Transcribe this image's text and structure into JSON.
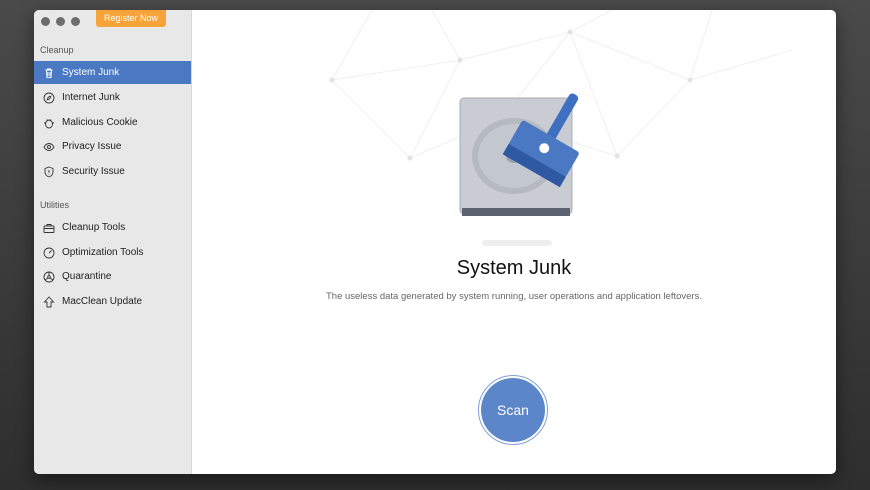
{
  "header": {
    "register_label": "Register Now"
  },
  "sidebar": {
    "cleanup_title": "Cleanup",
    "cleanup_items": [
      {
        "label": "System Junk",
        "icon": "trash-icon"
      },
      {
        "label": "Internet Junk",
        "icon": "compass-icon"
      },
      {
        "label": "Malicious Cookie",
        "icon": "cookie-bug-icon"
      },
      {
        "label": "Privacy Issue",
        "icon": "eye-icon"
      },
      {
        "label": "Security Issue",
        "icon": "shield-icon"
      }
    ],
    "utilities_title": "Utilities",
    "utility_items": [
      {
        "label": "Cleanup Tools",
        "icon": "toolbox-icon"
      },
      {
        "label": "Optimization Tools",
        "icon": "gauge-icon"
      },
      {
        "label": "Quarantine",
        "icon": "biohazard-icon"
      },
      {
        "label": "MacClean Update",
        "icon": "arrow-up-icon"
      }
    ]
  },
  "main": {
    "title": "System Junk",
    "description": "The useless data generated by system running, user operations and application leftovers.",
    "scan_label": "Scan"
  },
  "colors": {
    "accent": "#4a78c2",
    "register": "#f6a43a",
    "scan": "#5b86c9"
  }
}
